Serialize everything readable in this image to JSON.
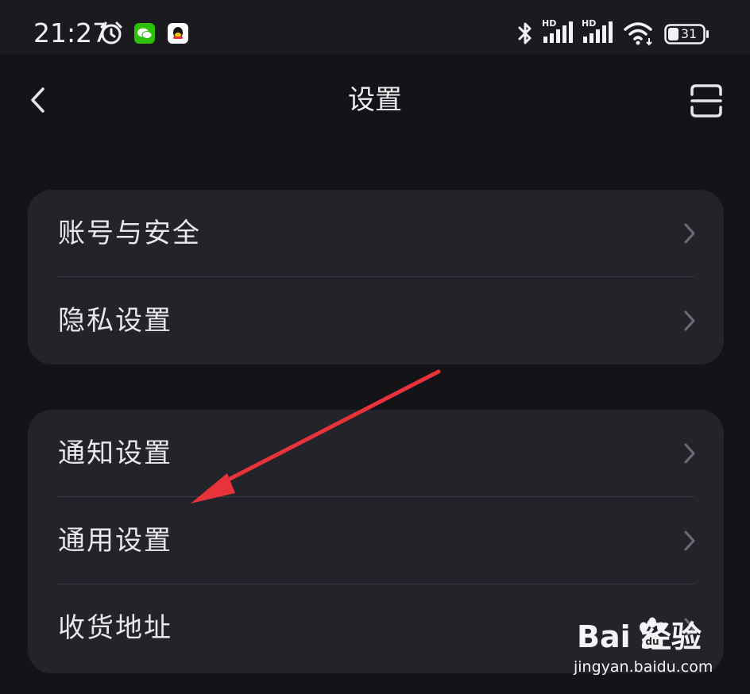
{
  "status_bar": {
    "time": "21:27",
    "battery_level": "31",
    "signal_label_1": "HD",
    "signal_label_2": "HD",
    "icons": [
      "alarm-icon",
      "wechat-icon",
      "qq-icon",
      "bluetooth-icon",
      "signal-icon",
      "signal-icon",
      "wifi-icon",
      "battery-icon"
    ]
  },
  "nav": {
    "title": "设置",
    "back_icon": "chevron-left-icon",
    "scan_icon": "scan-icon"
  },
  "groups": [
    {
      "items": [
        {
          "label": "账号与安全"
        },
        {
          "label": "隐私设置"
        }
      ]
    },
    {
      "items": [
        {
          "label": "通知设置"
        },
        {
          "label": "通用设置"
        },
        {
          "label": "收货地址"
        }
      ]
    }
  ],
  "watermark": {
    "brand": "Bai  经验",
    "url": "jingyan.baidu.com"
  },
  "colors": {
    "background": "#141418",
    "card": "#23232a",
    "annotation_arrow": "#e8333b",
    "wechat_green": "#2dc100"
  }
}
